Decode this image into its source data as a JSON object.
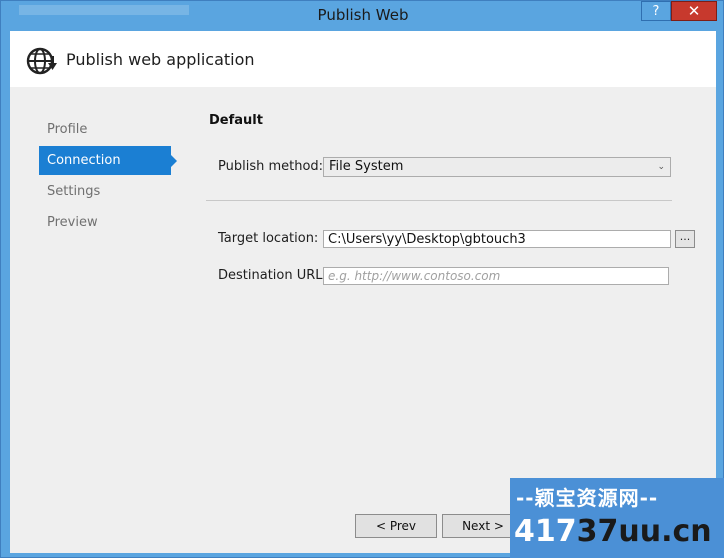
{
  "window": {
    "title": "Publish Web",
    "help_label": "?",
    "close_label": "✕"
  },
  "header": {
    "title": "Publish web application",
    "icon": "globe-icon"
  },
  "nav": {
    "items": [
      {
        "label": "Profile",
        "active": false
      },
      {
        "label": "Connection",
        "active": true
      },
      {
        "label": "Settings",
        "active": false
      },
      {
        "label": "Preview",
        "active": false
      }
    ]
  },
  "form": {
    "section_title": "Default",
    "publish_method_label": "Publish method:",
    "publish_method_value": "File System",
    "target_location_label": "Target location:",
    "target_location_value": "C:\\Users\\yy\\Desktop\\gbtouch3",
    "browse_label": "...",
    "destination_url_label": "Destination URL:",
    "destination_url_placeholder": "e.g. http://www.contoso.com"
  },
  "footer": {
    "prev_label": "< Prev",
    "next_label": "Next >"
  },
  "watermark": {
    "line1": "--颖宝资源网--",
    "line2_prefix": "417",
    "line2_main": "37uu.cn"
  },
  "colors": {
    "titlebar": "#5aa5e0",
    "accent": "#1b7fd3",
    "close": "#c7392d"
  }
}
